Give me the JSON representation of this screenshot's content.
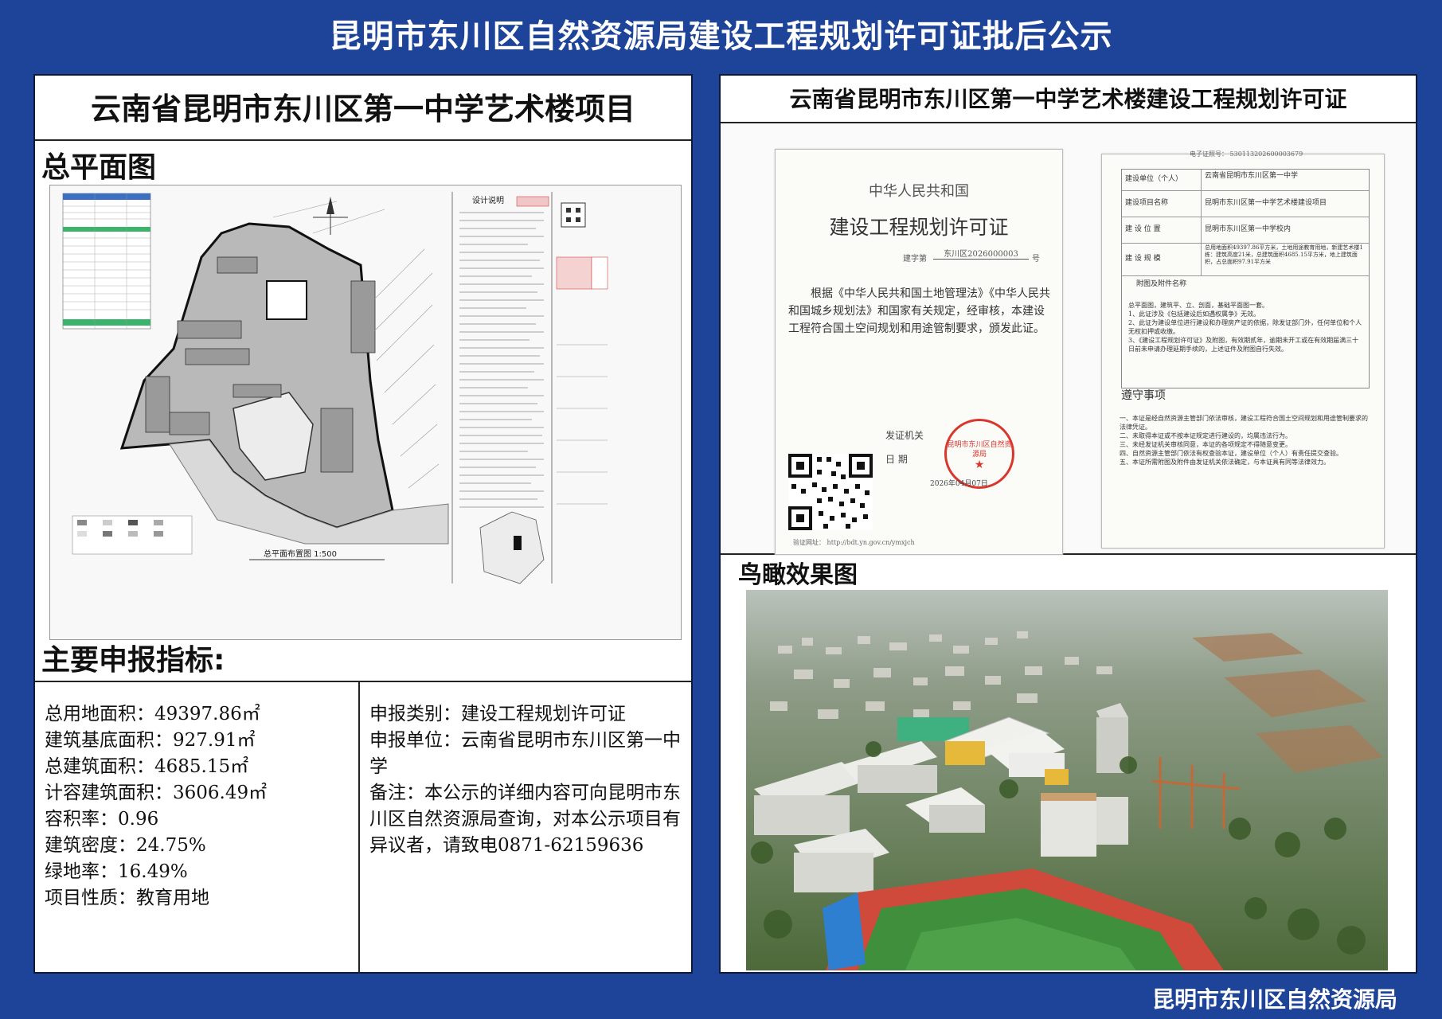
{
  "header": {
    "title": "昆明市东川区自然资源局建设工程规划许可证批后公示"
  },
  "footer": {
    "org": "昆明市东川区自然资源局"
  },
  "left": {
    "project_title": "云南省昆明市东川区第一中学艺术楼项目",
    "plan_label": "总平面图",
    "plan_caption": "总平面布置图 1:500",
    "plan_side_title": "设计说明",
    "metrics_label": "主要申报指标:",
    "metrics": [
      "总用地面积：49397.86㎡",
      "建筑基底面积：927.91㎡",
      "总建筑面积：4685.15㎡",
      "计容建筑面积：3606.49㎡",
      "容积率：0.96",
      "建筑密度：24.75%",
      "绿地率：16.49%",
      "项目性质：教育用地"
    ],
    "declare_type": "申报类别：建设工程规划许可证",
    "declare_unit": "申报单位：云南省昆明市东川区第一中学",
    "remark": "备注：本公示的详细内容可向昆明市东川区自然资源局查询，对本公示项目有异议者，请致电0871-62159636"
  },
  "right": {
    "permit_title": "云南省昆明市东川区第一中学艺术楼建设工程规划许可证",
    "cert_left": {
      "country": "中华人民共和国",
      "title": "建设工程规划许可证",
      "number_prefix": "建字第",
      "number": "东川区2026000003",
      "number_suffix": "号",
      "body": "根据《中华人民共和国土地管理法》《中华人民共和国城乡规划法》和国家有关规定，经审核，本建设工程符合国土空间规划和用途管制要求，颁发此证。",
      "issuer_label": "发证机关",
      "date_label": "日 期",
      "seal_text": "昆明市东川区自然资源局",
      "date": "2026年04月07日",
      "verify": "验证网址：  http://bdt.yn.gov.cn/ymxjch"
    },
    "cert_right": {
      "serial": "电子证照号：  530113202600003679",
      "rows": [
        {
          "label": "建设单位（个人）",
          "value": "云南省昆明市东川区第一中学"
        },
        {
          "label": "建设项目名称",
          "value": "昆明市东川区第一中学艺术楼建设项目"
        },
        {
          "label": "建 设 位 置",
          "value": "昆明市东川区第一中学校内"
        },
        {
          "label": "建 设 规 模",
          "value": "总用地面积49397.86平方米，土地用途教育用地，新建艺术楼1栋：建筑高度21米，总建筑面积4685.15平方米，地上建筑面积，占总面积97.91平方米"
        }
      ],
      "attach_title": "附图及附件名称",
      "attach_body": [
        "总平面图，建筑平、立、剖面，基础平面图一套。",
        "1、此证涉及《包括建设后如遇权属争》无效。",
        "2、此证为建设单位进行建设和办理房产证的依据，除发证部门外，任何单位和个人无权扣押或收缴。",
        "3、《建设工程规划许可证》及附图，有效期贰年，逾期未开工或在有效期届满三十日前未申请办理延期手续的，上述证件及附图自行失效。"
      ],
      "notice_title": "遵守事项",
      "notice_body": [
        "一、本证是经自然资源主管部门依法审核，建设工程符合国土空间规划和用途管制要求的法律凭证。",
        "二、未取得本证或不按本证规定进行建设的，均属违法行为。",
        "三、未经发证机关审核同意，本证的各项规定不得随意变更。",
        "四、自然资源主管部门依法有权查验本证，建设单位（个人）有责任提交查验。",
        "五、本证所需附图及附件由发证机关依法确定，与本证具有同等法律效力。"
      ]
    },
    "aerial_label": "鸟瞰效果图"
  },
  "colors": {
    "background": "#1e4499",
    "panel": "#ffffff",
    "seal": "#d9362e"
  }
}
